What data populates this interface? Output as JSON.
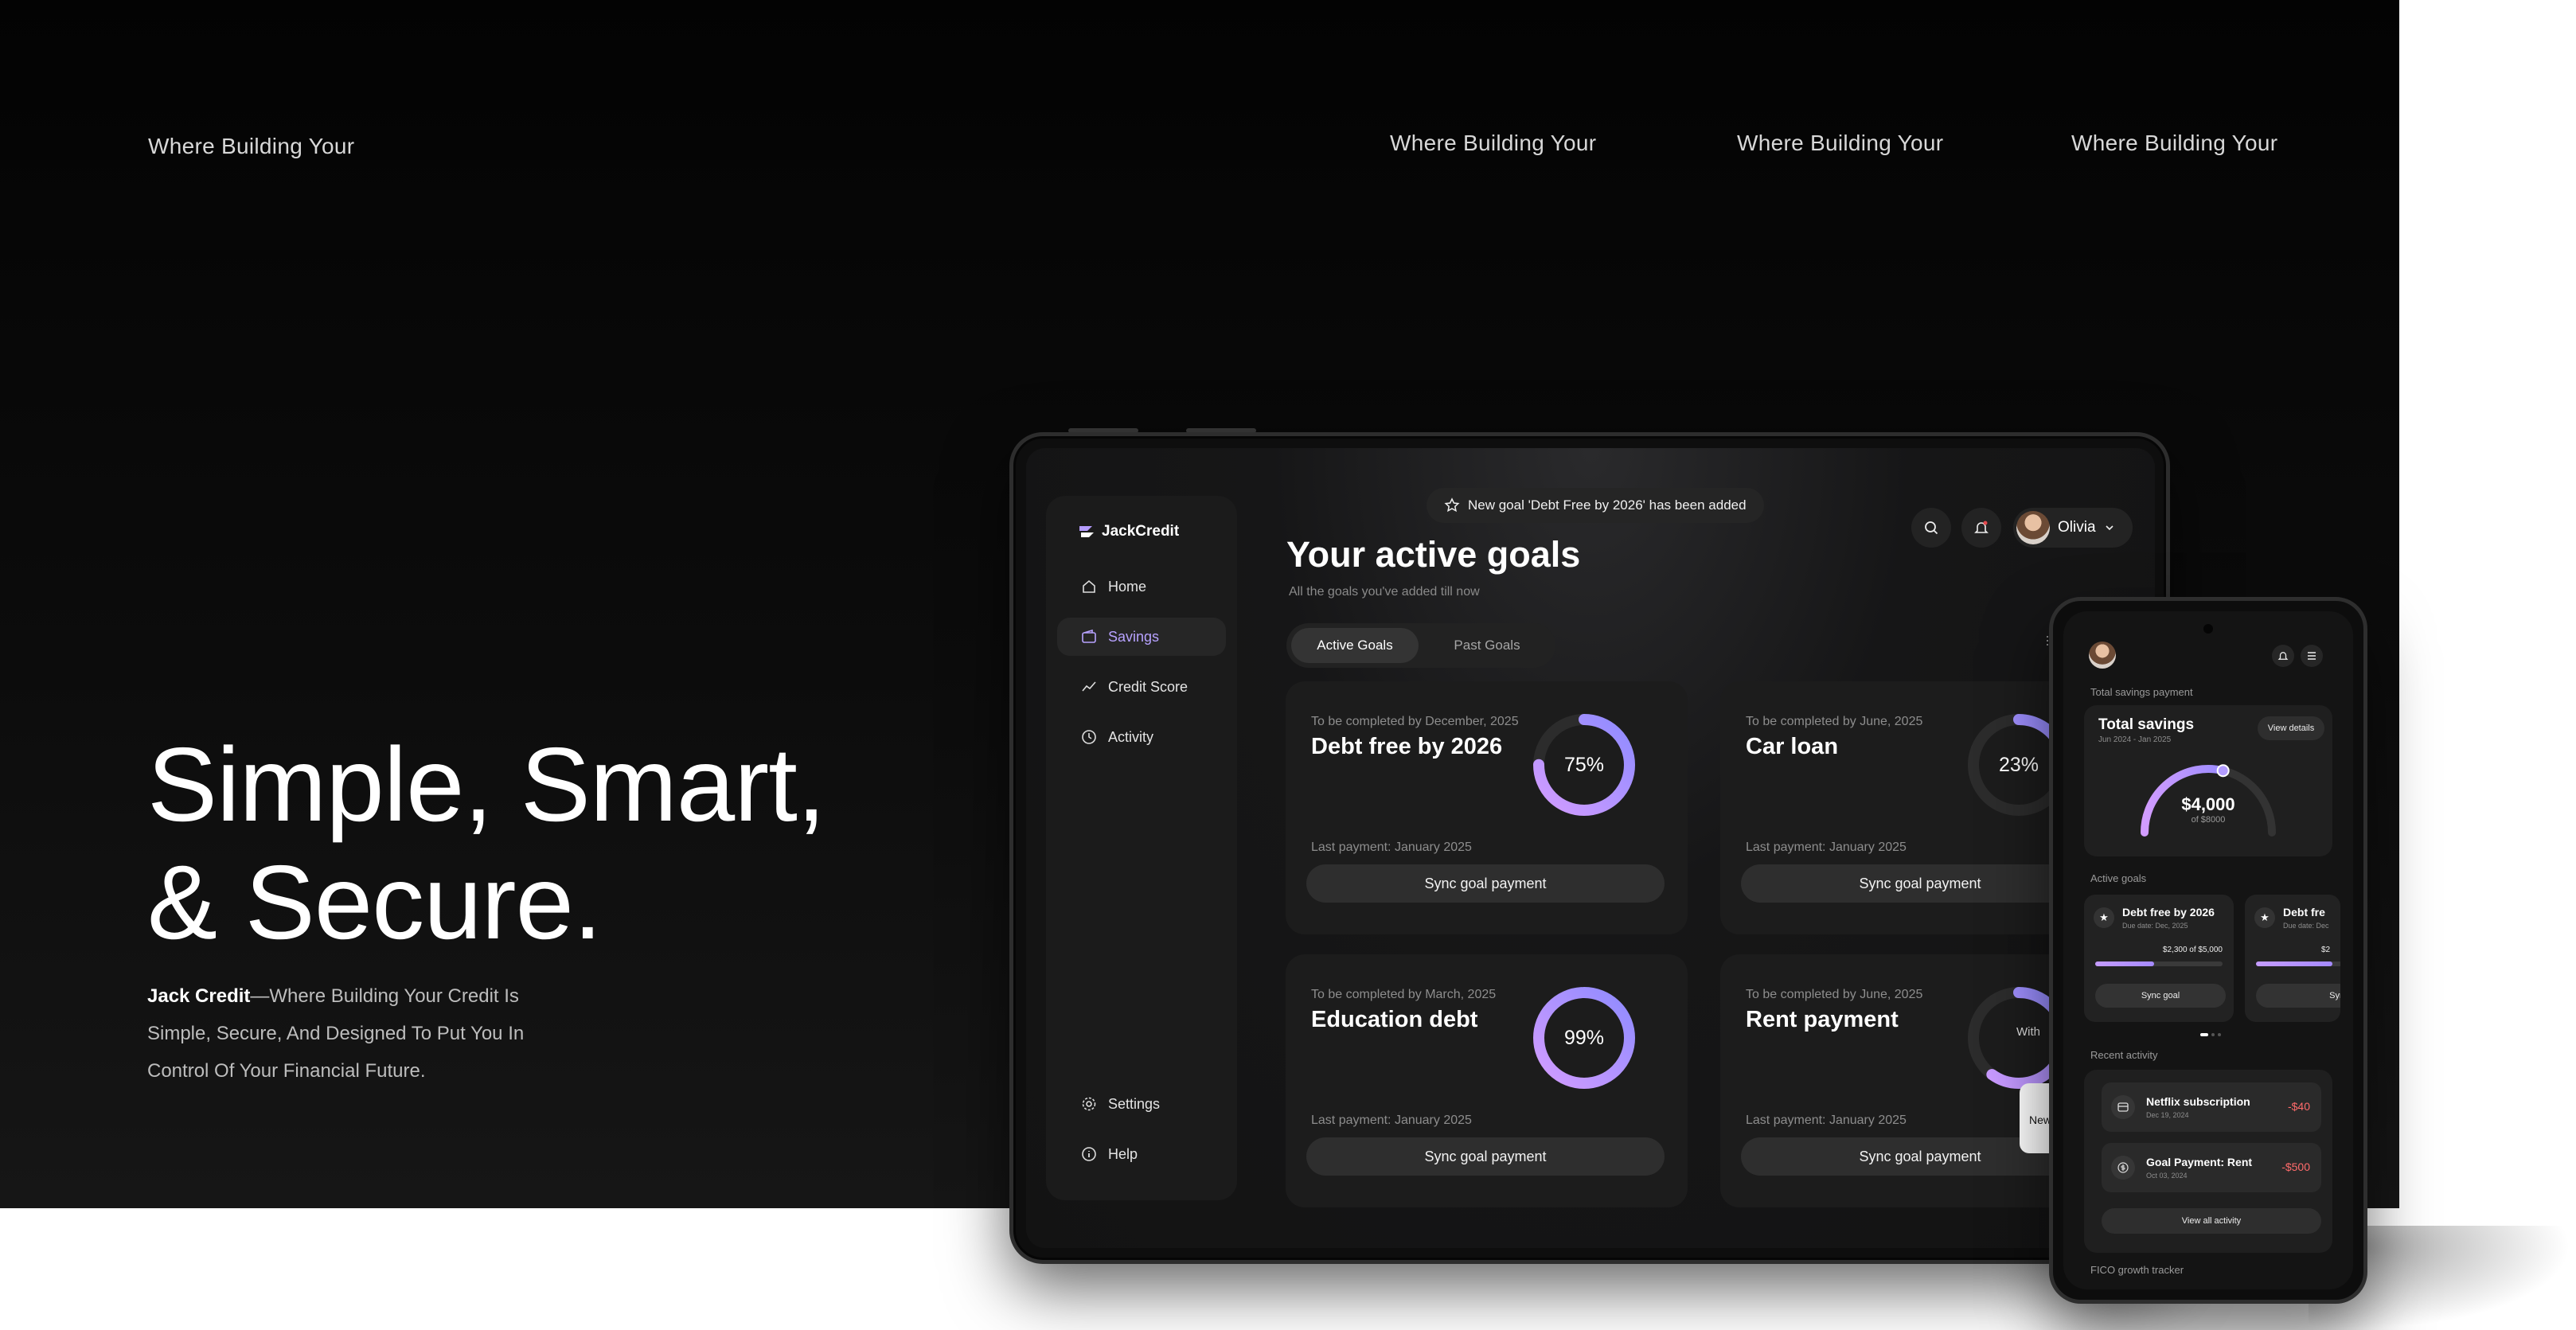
{
  "top_taglines": [
    "Where Building Your",
    "Where Building Your",
    "Where Building Your",
    "Where Building Your"
  ],
  "hero": {
    "headline_line1": "Simple, Smart,",
    "headline_line2": "& Secure.",
    "brand_bold": "Jack Credit",
    "description": "—Where Building Your Credit Is Simple, Secure, And Designed To Put You In Control Of Your Financial Future."
  },
  "tablet": {
    "brand": "JackCredit",
    "nav": [
      {
        "label": "Home",
        "icon": "home-icon"
      },
      {
        "label": "Savings",
        "icon": "wallet-icon",
        "active": true
      },
      {
        "label": "Credit Score",
        "icon": "trend-icon"
      },
      {
        "label": "Activity",
        "icon": "clock-icon"
      }
    ],
    "nav_bottom": [
      {
        "label": "Settings",
        "icon": "gear-icon"
      },
      {
        "label": "Help",
        "icon": "info-icon"
      }
    ],
    "banner": "New goal 'Debt Free by 2026' has been added",
    "title": "Your active goals",
    "subtitle": "All the goals you've added till now",
    "tabs": [
      "Active Goals",
      "Past Goals"
    ],
    "user_name": "Olivia",
    "goals": [
      {
        "due": "To be completed by December, 2025",
        "name": "Debt free by 2026",
        "percent": 75,
        "percent_label": "75%",
        "last": "Last payment: January 2025",
        "action": "Sync goal payment"
      },
      {
        "due": "To be completed by June, 2025",
        "name": "Car loan",
        "percent": 23,
        "percent_label": "23%",
        "last": "Last payment: January 2025",
        "action": "Sync goal payment"
      },
      {
        "due": "To be completed by March, 2025",
        "name": "Education debt",
        "percent": 99,
        "percent_label": "99%",
        "last": "Last payment: January 2025",
        "action": "Sync goal payment"
      },
      {
        "due": "To be completed by June, 2025",
        "name": "Rent payment",
        "percent": 60,
        "percent_label": "",
        "last": "Last payment: January 2025",
        "action": "Sync goal payment"
      }
    ],
    "peek_labels": [
      "With",
      "New"
    ]
  },
  "phone": {
    "total_label": "Total savings payment",
    "card_title": "Total savings",
    "card_range": "Jun 2024 - Jan 2025",
    "view_details": "View details",
    "amount": "$4,000",
    "of_amount": "of $8000",
    "progress": 0.5,
    "active_goals_label": "Active goals",
    "mini_goals": [
      {
        "name": "Debt free by 2026",
        "due": "Due date: Dec, 2025",
        "amount": "$2,300 of $5,000",
        "progress": 0.46,
        "action": "Sync goal"
      },
      {
        "name": "Debt fre",
        "due": "Due date: Dec",
        "amount": "$2",
        "progress": 0.6,
        "action": "Sync go"
      }
    ],
    "recent_label": "Recent activity",
    "activities": [
      {
        "name": "Netflix subscription",
        "date": "Dec 19, 2024",
        "amount": "-$40",
        "icon": "card-icon"
      },
      {
        "name": "Goal Payment: Rent",
        "date": "Oct 03, 2024",
        "amount": "-$500",
        "icon": "dollar-icon"
      }
    ],
    "view_all": "View all activity",
    "fico_label": "FICO growth tracker"
  }
}
